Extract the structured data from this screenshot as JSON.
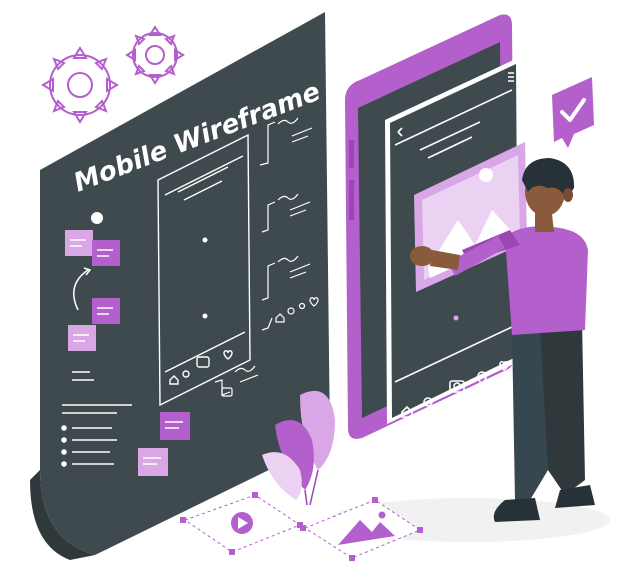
{
  "poster": {
    "title": "Mobile Wireframe"
  },
  "colors": {
    "board": "#3f4a4e",
    "board_dark": "#2f383b",
    "accent": "#b35fcc",
    "accent_light": "#d9a6e6",
    "accent_pale": "#ecd2f2",
    "line": "#ffffff",
    "skin": "#8a5a3c",
    "hair": "#263238",
    "pants": "#37474f"
  },
  "icons": {
    "gears": "gear-icon",
    "check_badge": "checkmark-icon",
    "play": "play-icon",
    "image": "image-icon",
    "home": "home-icon",
    "search": "search-icon",
    "camera": "camera-icon",
    "location": "location-pin-icon",
    "heart": "heart-icon",
    "menu": "menu-icon",
    "back": "chevron-left-icon"
  }
}
